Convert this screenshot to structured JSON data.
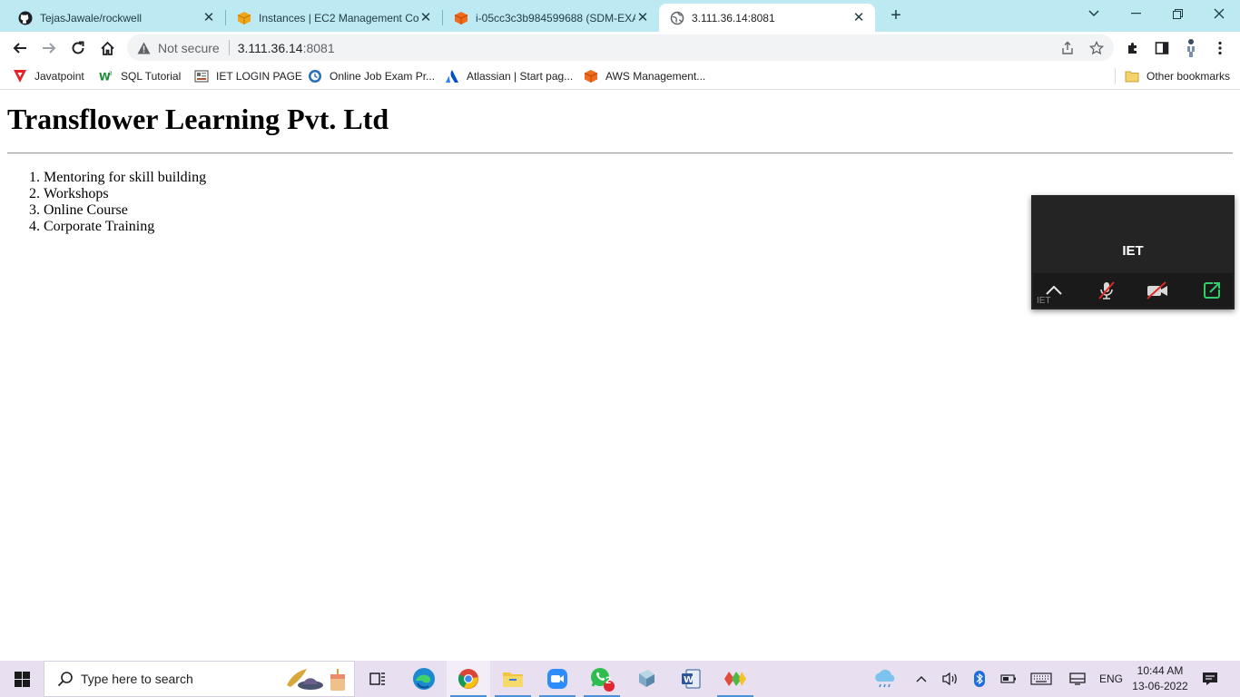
{
  "browser": {
    "tabs": [
      {
        "title": "TejasJawale/rockwell",
        "icon": "github-icon"
      },
      {
        "title": "Instances | EC2 Management Cor",
        "icon": "aws-box-icon"
      },
      {
        "title": "i-05cc3c3b984599688 (SDM-EXA",
        "icon": "aws-cube-icon"
      },
      {
        "title": "3.111.36.14:8081",
        "icon": "globe-icon",
        "active": true
      }
    ],
    "address": {
      "security_label": "Not secure",
      "host": "3.111.36.14",
      "port": ":8081"
    },
    "bookmarks": [
      {
        "label": "Javatpoint"
      },
      {
        "label": "SQL Tutorial"
      },
      {
        "label": "IET LOGIN PAGE"
      },
      {
        "label": "Online Job Exam Pr..."
      },
      {
        "label": "Atlassian | Start pag..."
      },
      {
        "label": "AWS Management..."
      }
    ],
    "other_bookmarks": "Other bookmarks"
  },
  "page": {
    "heading": "Transflower Learning Pvt. Ltd",
    "items": [
      "Mentoring for skill building",
      "Workshops",
      "Online Course",
      "Corporate Training"
    ]
  },
  "zoom": {
    "participant": "IET",
    "small_label": "IET"
  },
  "taskbar": {
    "search_placeholder": "Type here to search",
    "whatsapp_badge": "2",
    "language": "ENG",
    "time": "10:44 AM",
    "date": "13-06-2022"
  },
  "colors": {
    "tabstrip": "#bde9f3",
    "taskbar": "#e8dff0",
    "zoom_panel": "#242424",
    "mute_red": "#e02828"
  }
}
